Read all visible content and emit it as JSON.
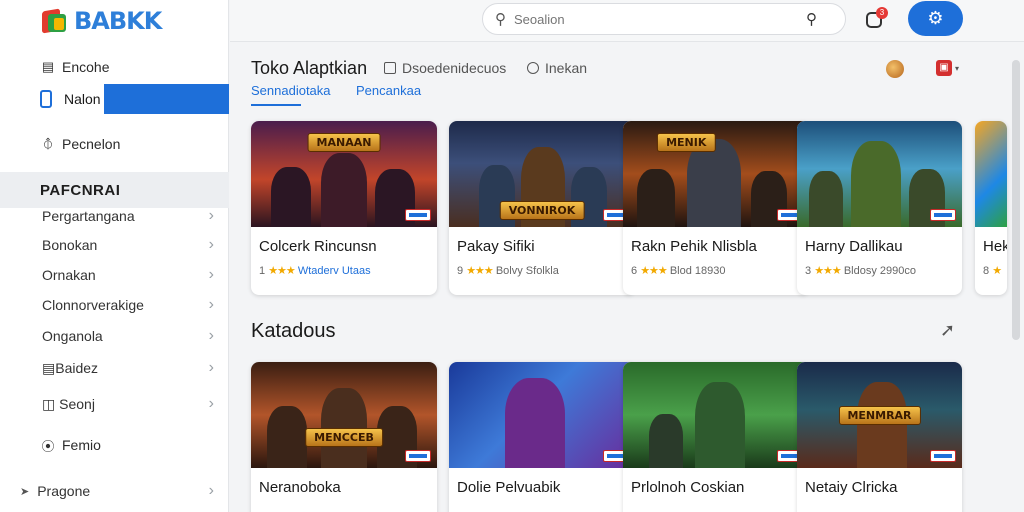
{
  "app": {
    "logo_text": "BABKK"
  },
  "sidebar": {
    "items": [
      {
        "label": "Encohe",
        "icon": "store-icon"
      },
      {
        "label": "Nalon",
        "icon": "phone-icon",
        "active": true
      },
      {
        "label": "Pecnelon",
        "icon": "compass-icon"
      }
    ],
    "section_title": "PAFCNRAI",
    "categories": [
      {
        "label": "Pergartangana"
      },
      {
        "label": "Bonokan"
      },
      {
        "label": "Ornakan"
      },
      {
        "label": "Clonnorverakige"
      },
      {
        "label": "Onganola"
      },
      {
        "label": "Baidez",
        "icon": "list-icon"
      },
      {
        "label": "Seonj",
        "icon": "book-icon"
      }
    ],
    "bottom_items": [
      {
        "label": "Femio",
        "icon": "circle-icon"
      },
      {
        "label": "Pragone",
        "icon": "arrow-icon"
      }
    ]
  },
  "topbar": {
    "search_placeholder": "Seoalion",
    "notification_count": "3"
  },
  "main": {
    "title": "Toko Alaptkian",
    "toolbar": [
      {
        "label": "Dsoedenidecuos",
        "icon": "square-icon"
      },
      {
        "label": "Inekan",
        "icon": "circle-icon"
      }
    ],
    "tabs": [
      {
        "label": "Sennadiotaka",
        "active": true
      },
      {
        "label": "Pencankaa"
      }
    ],
    "featured": [
      {
        "name": "Colcerk Rincunsn",
        "meta_prefix": "1",
        "stars": "★★★",
        "meta": "Wtaderv Utaas",
        "banner": "MANAAN"
      },
      {
        "name": "Pakay Sifiki",
        "meta_prefix": "9",
        "stars": "★★★",
        "meta": "Bolvy Sfolkla",
        "banner": "VONNIROK"
      },
      {
        "name": "Rakn Pehik Nlisbla",
        "meta_prefix": "6",
        "stars": "★★★",
        "meta": "Blod 18930",
        "banner": "MENIK"
      },
      {
        "name": "Harny Dallikau",
        "meta_prefix": "3",
        "stars": "★★★",
        "meta": "Bldosy 2990co",
        "banner": ""
      },
      {
        "name": "Hek",
        "meta_prefix": "8",
        "stars": "★",
        "meta": "",
        "banner": ""
      }
    ],
    "section2_title": "Katadous",
    "section2_items": [
      {
        "name": "Neranoboka",
        "banner": "MENCCEB"
      },
      {
        "name": "Dolie Pelvuabik",
        "banner": ""
      },
      {
        "name": "Prlolnoh Coskian",
        "banner": ""
      },
      {
        "name": "Netaiy Clricka",
        "banner": "MENMRAR"
      }
    ]
  },
  "colors": {
    "accent": "#1e6fd9",
    "star": "#f2a900"
  }
}
